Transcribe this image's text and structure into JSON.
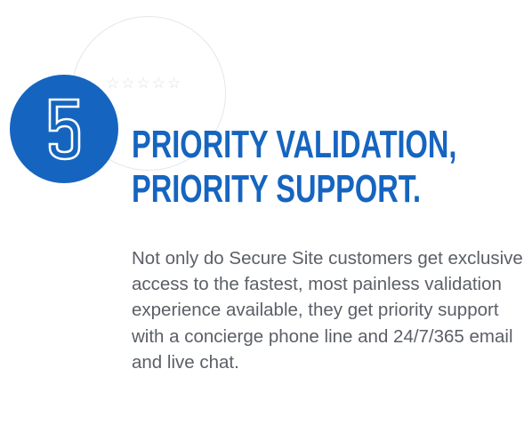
{
  "badge": {
    "number": "5",
    "color": "#1565c0",
    "number_icon": "outlined-digit-five"
  },
  "decoration": {
    "stars_icon": "five-outline-stars-icon",
    "stars": "☆☆☆☆☆"
  },
  "heading": {
    "line1": "PRIORITY VALIDATION,",
    "line2": "PRIORITY SUPPORT."
  },
  "body": {
    "text": "Not only do Secure Site customers get exclusive access to the fastest, most painless validation experience available, they get priority support with a concierge phone line and 24/7/365 email and live chat."
  },
  "colors": {
    "accent": "#1565c0",
    "body_text": "#5b5f66",
    "decoration": "#dcdfe4"
  }
}
